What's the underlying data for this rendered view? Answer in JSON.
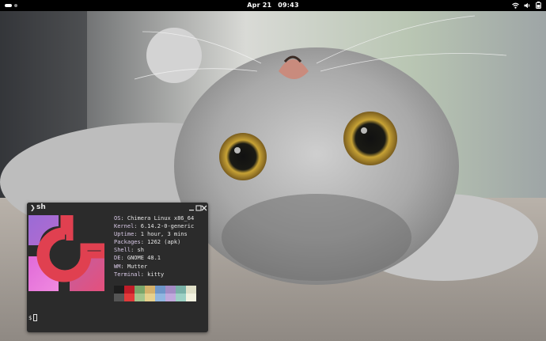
{
  "topbar": {
    "date": "Apr 21",
    "time": "09:43",
    "icons": [
      "workspace-indicator",
      "wifi-icon",
      "speaker-icon",
      "battery-icon"
    ]
  },
  "terminal": {
    "title_symbol": "❯",
    "title": "sh",
    "window_buttons": [
      "minimize-icon",
      "maximize-icon",
      "close-icon"
    ],
    "logo": "chimera-logo",
    "info": [
      {
        "key": "OS",
        "value": "Chimera Linux x86_64"
      },
      {
        "key": "Kernel",
        "value": "6.14.2-0-generic"
      },
      {
        "key": "Uptime",
        "value": "1 hour, 3 mins"
      },
      {
        "key": "Packages",
        "value": "1262 (apk)"
      },
      {
        "key": "Shell",
        "value": "sh"
      },
      {
        "key": "DE",
        "value": "GNOME 48.1"
      },
      {
        "key": "WM",
        "value": "Mutter"
      },
      {
        "key": "Terminal",
        "value": "kitty"
      }
    ],
    "palette": {
      "row1": [
        "#1d1d1d",
        "#c01c28",
        "#7aa56a",
        "#d4b06a",
        "#6d95c8",
        "#a38bc4",
        "#78b0a6",
        "#e0e0c8"
      ],
      "row2": [
        "#555555",
        "#e23a3a",
        "#a3c48d",
        "#e6d08c",
        "#90b6e0",
        "#c0a8dc",
        "#9cd0c4",
        "#f2f2e0"
      ]
    },
    "prompt": "$"
  }
}
